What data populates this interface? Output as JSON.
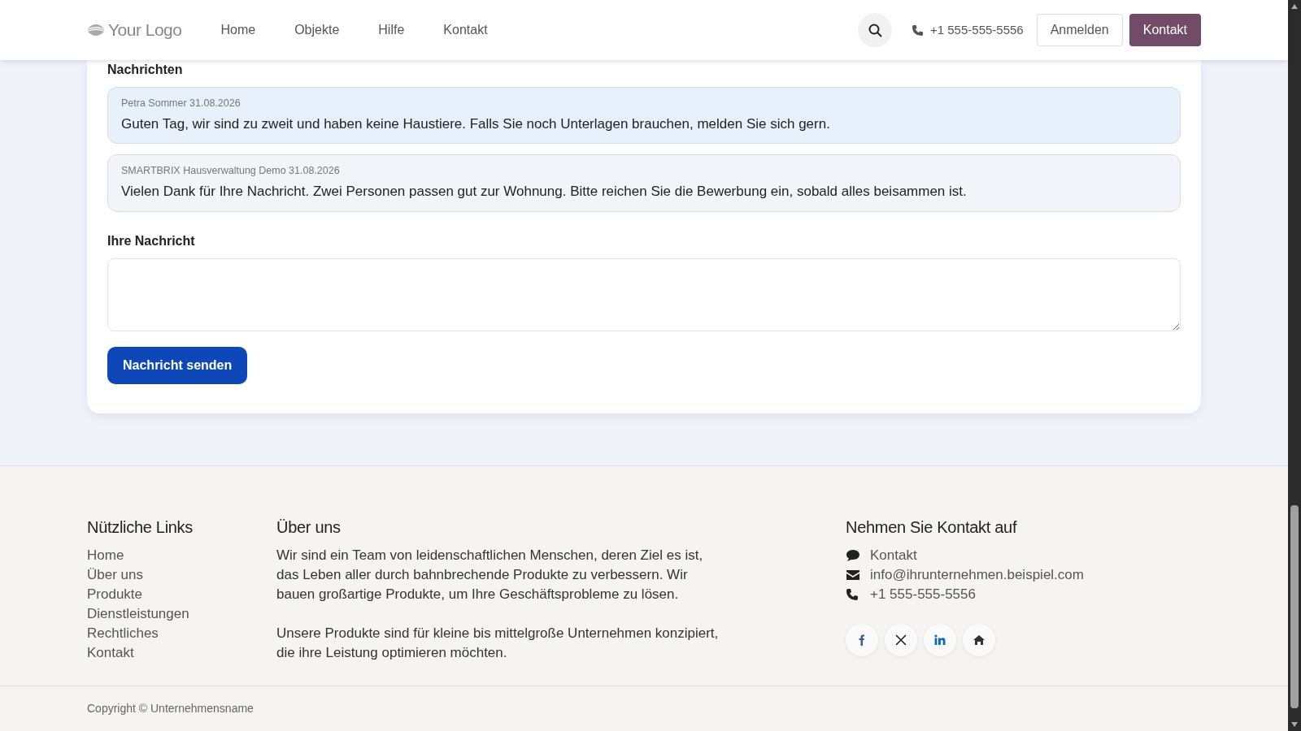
{
  "navbar": {
    "logo": "Your Logo",
    "links": [
      {
        "label": "Home"
      },
      {
        "label": "Objekte"
      },
      {
        "label": "Hilfe"
      },
      {
        "label": "Kontakt"
      }
    ],
    "phone": "+1 555-555-5556",
    "login_button": "Anmelden",
    "contact_button": "Kontakt"
  },
  "messages_section": {
    "title": "Nachrichten",
    "messages": [
      {
        "kind": "own",
        "meta": "Petra Sommer 31.08.2026",
        "text": "Guten Tag, wir sind zu zweit und haben keine Haustiere. Falls Sie noch Unterlagen brauchen, melden Sie sich gern."
      },
      {
        "kind": "other",
        "meta": "SMARTBRIX Hausverwaltung Demo 31.08.2026",
        "text": "Vielen Dank für Ihre Nachricht. Zwei Personen passen gut zur Wohnung. Bitte reichen Sie die Bewerbung ein, sobald alles beisammen ist."
      }
    ],
    "input_label": "Ihre Nachricht",
    "send_button": "Nachricht senden"
  },
  "footer": {
    "links_title": "Nützliche Links",
    "links": [
      "Home",
      "Über uns",
      "Produkte",
      "Dienstleistungen",
      "Rechtliches",
      "Kontakt"
    ],
    "about_title": "Über uns",
    "about_paragraphs": [
      "Wir sind ein Team von leidenschaftlichen Menschen, deren Ziel es ist, das Leben aller durch bahnbrechende Produkte zu verbessern. Wir bauen großartige Produkte, um Ihre Geschäftsprobleme zu lösen.",
      "Unsere Produkte sind für kleine bis mittelgroße Unternehmen konzipiert, die ihre Leistung optimieren möchten."
    ],
    "contact_title": "Nehmen Sie Kontakt auf",
    "contacts": [
      {
        "kind": "chat",
        "label": "Kontakt"
      },
      {
        "kind": "email",
        "label": "info@ihrunternehmen.beispiel.com"
      },
      {
        "kind": "phone",
        "label": "+1 555-555-5556"
      }
    ],
    "social": [
      {
        "kind": "facebook"
      },
      {
        "kind": "x"
      },
      {
        "kind": "linkedin"
      },
      {
        "kind": "home"
      }
    ],
    "copyright": "Copyright © Unternehmensname"
  }
}
